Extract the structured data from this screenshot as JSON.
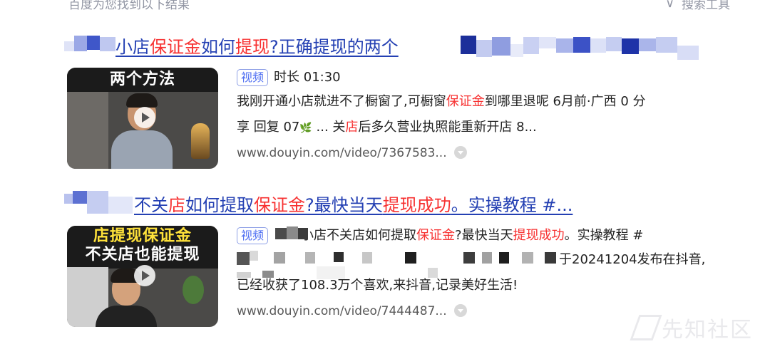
{
  "top": {
    "left_text": "百度为您找到以下结果",
    "right_text": "搜索工具",
    "filter_icon": "funnel-icon"
  },
  "results": [
    {
      "title_parts": [
        "小店",
        "保证金",
        "如何",
        "提现",
        "?正确提现的两个"
      ],
      "thumb_banner": "两个方法",
      "tag": "视频",
      "duration": "时长 01:30",
      "snippet1_parts": [
        "我刚开通小店就进不了橱窗了,可橱窗",
        "保证金",
        "到哪里退呢 6月前·广西 0 分"
      ],
      "snippet2_parts": [
        "享 回复 07",
        " ... 关",
        "店",
        "后多久营业执照能重新开店 8..."
      ],
      "url": "www.douyin.com/video/7367583..."
    },
    {
      "title_parts": [
        "不关",
        "店",
        "如何提取",
        "保证金",
        "?最快当天",
        "提现成功",
        "。实操教程 #..."
      ],
      "thumb_banner_line1": "店提现保证金",
      "thumb_banner_line2": "不关店也能提现",
      "tag": "视频",
      "snippet1_parts": [
        "小店不关店如何提取",
        "保证金",
        "?最快当天",
        "提现成功",
        "。实操教程 #"
      ],
      "snippet2": "于20241204发布在抖音,",
      "snippet3": "已经收获了108.3万个喜欢,来抖音,记录美好生活!",
      "url": "www.douyin.com/video/7444487..."
    }
  ],
  "watermark": "先知社区",
  "colors": {
    "link": "#2440b3",
    "highlight": "#f73131",
    "tag_border": "#8ea0e6",
    "tag_text": "#4e6ef2"
  }
}
